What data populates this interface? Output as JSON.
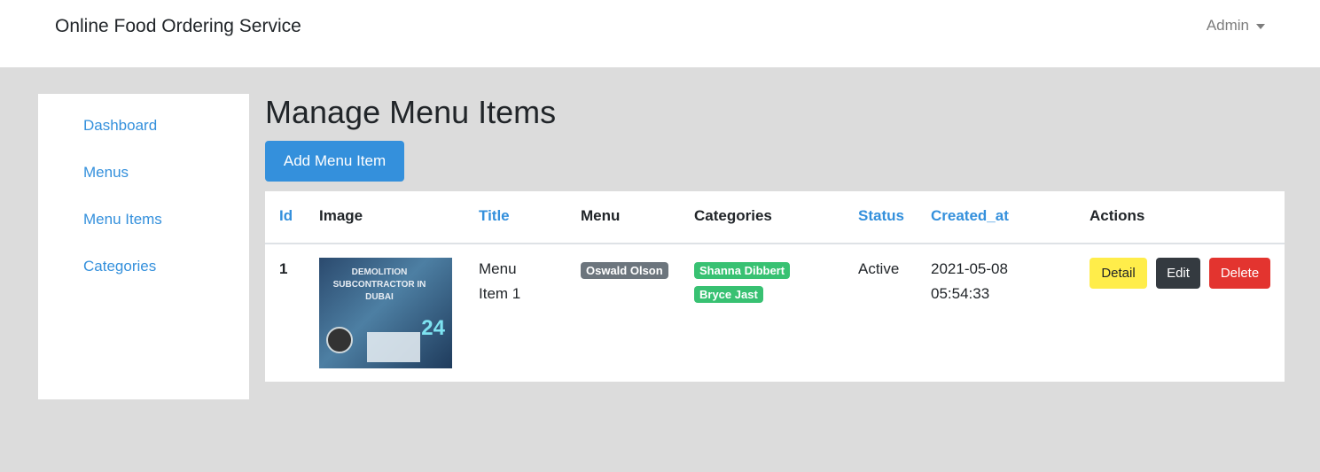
{
  "header": {
    "brand": "Online Food Ordering Service",
    "user_menu": "Admin"
  },
  "sidebar": {
    "items": [
      {
        "label": "Dashboard"
      },
      {
        "label": "Menus"
      },
      {
        "label": "Menu Items"
      },
      {
        "label": "Categories"
      }
    ]
  },
  "main": {
    "title": "Manage Menu Items",
    "add_button": "Add Menu Item"
  },
  "table": {
    "headers": [
      "Id",
      "Image",
      "Title",
      "Menu",
      "Categories",
      "Status",
      "Created_at",
      "Actions"
    ],
    "rows": [
      {
        "id": "1",
        "image_alt": "Demolition subcontractor in Dubai image",
        "image_text": "DEMOLITION SUBCONTRACTOR IN DUBAI",
        "image_number": "24",
        "title_line1": "Menu",
        "title_line2": "Item 1",
        "menu": "Oswald Olson",
        "categories": [
          "Shanna Dibbert",
          "Bryce Jast"
        ],
        "status": "Active",
        "created_date": "2021-05-08",
        "created_time": "05:54:33",
        "actions": {
          "detail": "Detail",
          "edit": "Edit",
          "delete": "Delete"
        }
      }
    ]
  },
  "colors": {
    "primary": "#3490dc",
    "page_bg": "#dcdcdc",
    "badge_menu": "#6c757d",
    "badge_category": "#38c172",
    "detail_button": "#ffed4a",
    "edit_button": "#343a40",
    "delete_button": "#e3342f"
  }
}
